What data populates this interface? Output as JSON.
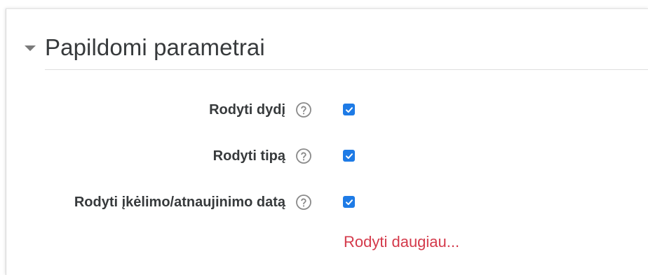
{
  "section": {
    "title": "Papildomi parametrai",
    "collapse_icon": "caret-down-icon"
  },
  "options": [
    {
      "label": "Rodyti dydį",
      "help_icon": "question-circle-icon",
      "checked": true
    },
    {
      "label": "Rodyti tipą",
      "help_icon": "question-circle-icon",
      "checked": true
    },
    {
      "label": "Rodyti įkėlimo/atnaujinimo datą",
      "help_icon": "question-circle-icon",
      "checked": true
    }
  ],
  "show_more_label": "Rodyti daugiau...",
  "colors": {
    "checkbox": "#1e7be6",
    "link": "#d43a4b",
    "text": "#373a3c"
  }
}
